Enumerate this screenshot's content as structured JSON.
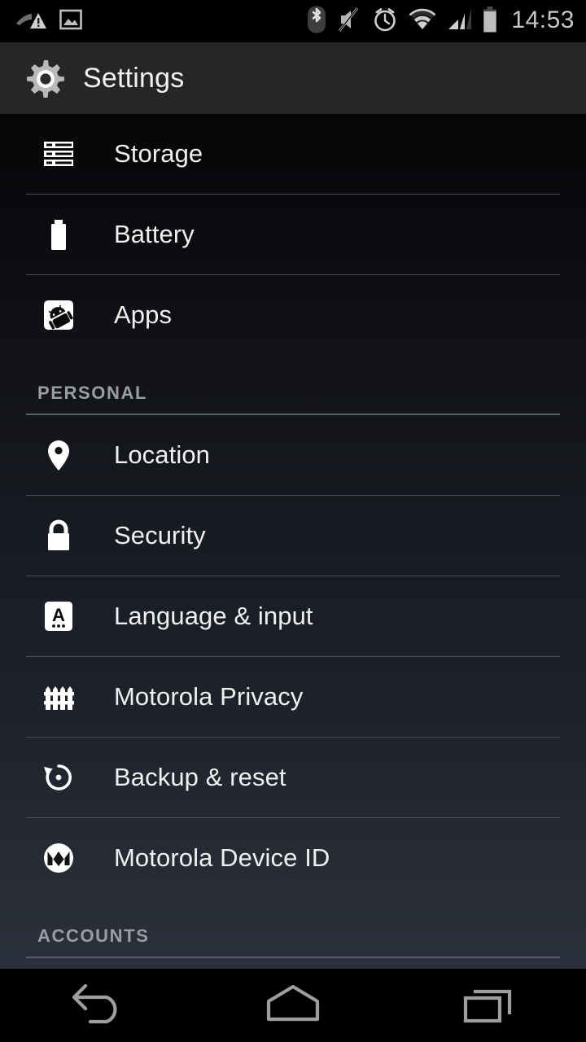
{
  "statusbar": {
    "time": "14:53",
    "left_icons": [
      {
        "name": "signal-warning-icon",
        "label": "no-service-warning"
      },
      {
        "name": "screenshot-image-icon",
        "label": "screenshot-captured"
      }
    ],
    "right_icons": [
      {
        "name": "bluetooth-icon",
        "label": "bluetooth-on"
      },
      {
        "name": "volume-mute-icon",
        "label": "sound-muted"
      },
      {
        "name": "alarm-clock-icon",
        "label": "alarm-set"
      },
      {
        "name": "wifi-icon",
        "label": "wifi-connected"
      },
      {
        "name": "cellular-signal-icon",
        "label": "cellular-signal"
      },
      {
        "name": "battery-icon",
        "label": "battery-level"
      }
    ]
  },
  "actionbar": {
    "title": "Settings",
    "icon": "gear-icon"
  },
  "list": [
    {
      "type": "item",
      "label": "Storage",
      "icon": "storage-icon"
    },
    {
      "type": "divider"
    },
    {
      "type": "item",
      "label": "Battery",
      "icon": "battery-icon"
    },
    {
      "type": "divider"
    },
    {
      "type": "item",
      "label": "Apps",
      "icon": "apps-android-icon"
    },
    {
      "type": "section",
      "label": "PERSONAL"
    },
    {
      "type": "item",
      "label": "Location",
      "icon": "location-pin-icon"
    },
    {
      "type": "divider"
    },
    {
      "type": "item",
      "label": "Security",
      "icon": "lock-icon"
    },
    {
      "type": "divider"
    },
    {
      "type": "item",
      "label": "Language & input",
      "icon": "language-a-icon"
    },
    {
      "type": "divider"
    },
    {
      "type": "item",
      "label": "Motorola Privacy",
      "icon": "fence-icon"
    },
    {
      "type": "divider"
    },
    {
      "type": "item",
      "label": "Backup & reset",
      "icon": "backup-restore-icon"
    },
    {
      "type": "divider"
    },
    {
      "type": "item",
      "label": "Motorola Device ID",
      "icon": "motorola-logo-icon"
    },
    {
      "type": "section",
      "label": "ACCOUNTS"
    },
    {
      "type": "partial",
      "label": "",
      "icon": "drive-account-icon"
    }
  ],
  "navbar": {
    "buttons": [
      {
        "name": "back-button",
        "icon": "back-arrow-icon"
      },
      {
        "name": "home-button",
        "icon": "home-icon"
      },
      {
        "name": "recents-button",
        "icon": "recents-icon"
      }
    ]
  },
  "colors": {
    "statusbar_bg": "#000000",
    "actionbar_bg": "#262626",
    "text_primary": "#f0f0f0",
    "text_section": "#9a9da2",
    "divider": "#4a4d52",
    "navbar_bg": "#000000",
    "accent_yellow": "#f7d10a"
  }
}
